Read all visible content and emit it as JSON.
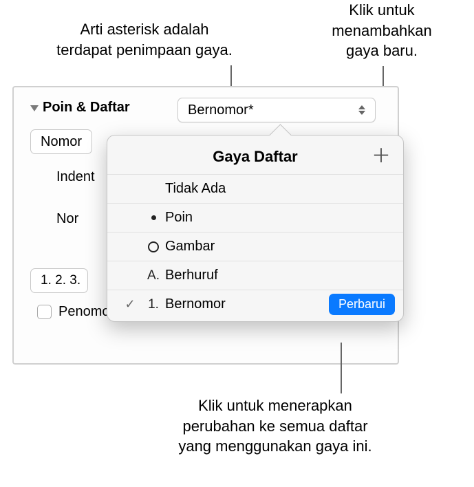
{
  "callouts": {
    "asterisk_line1": "Arti asterisk adalah",
    "asterisk_line2": "terdapat penimpaan gaya.",
    "add_line1": "Klik untuk",
    "add_line2": "menambahkan",
    "add_line3": "gaya baru.",
    "update_line1": "Klik untuk menerapkan",
    "update_line2": "perubahan ke semua daftar",
    "update_line3": "yang menggunakan gaya ini."
  },
  "panel": {
    "section_title": "Poin & Daftar",
    "style_selected": "Bernomor*",
    "sub_select": "Nomor",
    "indent_label": "Indent",
    "nor_label": "Nor",
    "num_style": "1. 2. 3.",
    "tiered_label": "Penomoran Bertingkat"
  },
  "popover": {
    "title": "Gaya Daftar",
    "add_glyph": "＋",
    "items": [
      {
        "marker": "",
        "label": "Tidak Ada",
        "checked": false
      },
      {
        "marker": "dot",
        "label": "Poin",
        "checked": false
      },
      {
        "marker": "ring",
        "label": "Gambar",
        "checked": false
      },
      {
        "marker": "A.",
        "label": "Berhuruf",
        "checked": false
      },
      {
        "marker": "1.",
        "label": "Bernomor",
        "checked": true
      }
    ],
    "check_glyph": "✓",
    "update_label": "Perbarui"
  }
}
